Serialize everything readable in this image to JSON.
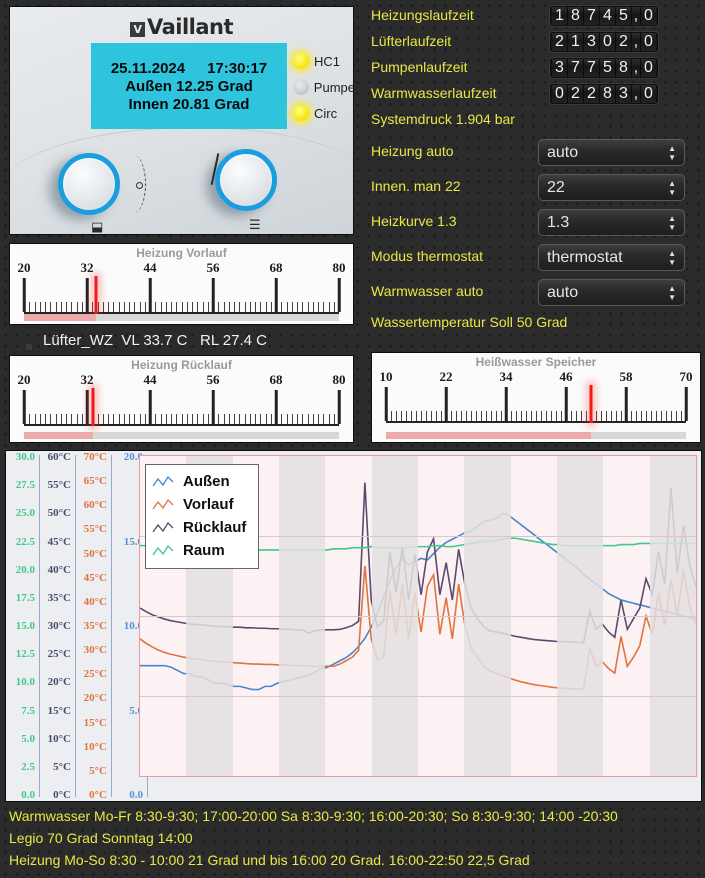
{
  "boiler": {
    "brand": "Vaillant",
    "brand_mark": "V",
    "display": {
      "date": "25.11.2024",
      "time": "17:30:17",
      "outside": "Außen 12.25 Grad",
      "inside": "Innen 20.81 Grad"
    },
    "leds": [
      {
        "label": "HC1",
        "state": "on"
      },
      {
        "label": "Pumpe",
        "state": "off"
      },
      {
        "label": "Circ",
        "state": "on"
      }
    ],
    "knob_left_icon": "⬓",
    "knob_right_icon": "☰"
  },
  "counters": [
    {
      "label": "Heizungslaufzeit",
      "digits": "18745",
      "decimal": "0",
      "separator": ","
    },
    {
      "label": "Lüfterlaufzeit",
      "digits": "21302",
      "decimal": "0",
      "separator": ","
    },
    {
      "label": "Pumpenlaufzeit",
      "digits": "37758",
      "decimal": "0",
      "separator": ","
    },
    {
      "label": "Warmwasserlaufzeit",
      "digits": "02283",
      "decimal": "0",
      "separator": ","
    }
  ],
  "system_pressure": "Systemdruck 1.904 bar",
  "water_temp_target": "Wassertemperatur Soll 50 Grad",
  "controls": [
    {
      "label": "Heizung auto",
      "value": "auto"
    },
    {
      "label": "Innen. man 22",
      "value": "22"
    },
    {
      "label": "Heizkurve 1.3",
      "value": "1.3"
    },
    {
      "label": "Modus thermostat",
      "value": "thermostat"
    },
    {
      "label": "Warmwasser auto",
      "value": "auto"
    }
  ],
  "status_line": {
    "lamp": "off",
    "text": "Lüfter_WZ  VL 33.7 C   RL 27.4 C"
  },
  "gauges": [
    {
      "title": "Heizung Vorlauf",
      "min": 20,
      "max": 80,
      "ticks": [
        20,
        32,
        44,
        56,
        68,
        80
      ],
      "value": 33.7
    },
    {
      "title": "Heizung Rücklauf",
      "min": 20,
      "max": 80,
      "ticks": [
        20,
        32,
        44,
        56,
        68,
        80
      ],
      "value": 33.2
    },
    {
      "title": "Heißwasser Speicher",
      "min": 10,
      "max": 70,
      "ticks": [
        10,
        22,
        34,
        46,
        58,
        70
      ],
      "value": 51.0
    }
  ],
  "chart_data": {
    "type": "line",
    "title": "",
    "xlabel": "",
    "grid": true,
    "legend_position": "top-left",
    "axes": [
      {
        "name": "Raum",
        "color": "#3fc98a",
        "min": 0.0,
        "max": 30.0,
        "step": 2.5,
        "ticks": [
          "0.0",
          "2.5",
          "5.0",
          "7.5",
          "10.0",
          "12.5",
          "15.0",
          "17.5",
          "20.0",
          "22.5",
          "25.0",
          "27.5",
          "30.0"
        ]
      },
      {
        "name": "Rücklauf",
        "color": "#4a4a6a",
        "min": 0,
        "max": 60,
        "step": 5,
        "ticks": [
          "0°C",
          "5°C",
          "10°C",
          "15°C",
          "20°C",
          "25°C",
          "30°C",
          "35°C",
          "40°C",
          "45°C",
          "50°C",
          "55°C",
          "60°C"
        ]
      },
      {
        "name": "Vorlauf",
        "color": "#e2733f",
        "min": 0,
        "max": 70,
        "step": 5,
        "ticks": [
          "0°C",
          "5°C",
          "10°C",
          "15°C",
          "20°C",
          "25°C",
          "30°C",
          "35°C",
          "40°C",
          "45°C",
          "50°C",
          "55°C",
          "60°C",
          "65°C",
          "70°C"
        ]
      },
      {
        "name": "Außen",
        "color": "#5a8fd0",
        "min": 0.0,
        "max": 20.0,
        "step": 5,
        "ticks": [
          "0.0",
          "5.0",
          "10.0",
          "15.0",
          "20.0"
        ]
      }
    ],
    "series": [
      {
        "name": "Außen",
        "color": "#4a86c8",
        "axis": "Außen",
        "values": [
          6.9,
          6.9,
          6.9,
          6.9,
          6.9,
          6.8,
          6.6,
          6.4,
          6.4,
          6.2,
          6.2,
          6.0,
          5.8,
          5.8,
          5.7,
          5.6,
          5.6,
          5.5,
          5.4,
          5.4,
          5.6,
          5.6,
          5.8,
          5.9,
          6.0,
          6.1,
          6.2,
          6.3,
          6.5,
          6.7,
          6.8,
          7.0,
          7.2,
          7.4,
          7.7,
          8.1,
          8.6,
          9.3,
          10.2,
          11.2,
          12.2,
          13.0,
          13.6,
          13.2,
          13.4,
          13.6,
          13.5,
          13.9,
          14.3,
          14.6,
          14.8,
          15.0,
          15.2,
          15.3,
          15.6,
          15.9,
          16.0,
          16.1,
          16.4,
          16.3,
          16.0,
          15.7,
          15.4,
          15.1,
          14.8,
          14.5,
          14.2,
          13.9,
          13.6,
          13.3,
          13.0,
          12.6,
          12.3,
          12.0,
          11.7,
          11.4,
          11.2,
          11.0,
          10.9,
          10.8,
          10.7,
          10.6,
          10.5,
          10.4,
          10.3,
          10.2,
          10.1,
          10.0,
          9.9,
          9.8
        ]
      },
      {
        "name": "Vorlauf",
        "color": "#e2733f",
        "axis": "Vorlauf",
        "values": [
          30.0,
          29.0,
          28.2,
          27.5,
          27.0,
          26.6,
          26.3,
          26.0,
          25.8,
          25.6,
          25.4,
          25.2,
          25.1,
          25.0,
          24.9,
          24.8,
          24.7,
          24.6,
          24.5,
          24.5,
          24.4,
          24.4,
          24.3,
          24.3,
          24.2,
          24.2,
          24.1,
          24.1,
          24.0,
          24.0,
          24.0,
          24.0,
          24.5,
          25.2,
          26.0,
          27.5,
          46.0,
          30.0,
          25.5,
          26.0,
          40.5,
          31.0,
          42.0,
          30.0,
          40.0,
          31.5,
          41.5,
          44.0,
          31.0,
          39.0,
          30.0,
          42.0,
          33.0,
          28.0,
          26.0,
          24.0,
          23.0,
          22.5,
          22.0,
          21.5,
          21.0,
          20.6,
          20.3,
          20.0,
          19.8,
          19.6,
          19.4,
          19.3,
          19.2,
          19.1,
          19.0,
          19.0,
          28.0,
          24.0,
          25.0,
          23.5,
          22.5,
          30.5,
          24.0,
          26.0,
          28.5,
          35.0,
          31.0,
          40.0,
          33.0,
          43.0,
          35.0,
          45.0,
          37.0,
          33.0
        ]
      },
      {
        "name": "Rücklauf",
        "color": "#5b4a6e",
        "axis": "Rücklauf",
        "values": [
          31.5,
          30.8,
          30.2,
          29.8,
          29.4,
          29.1,
          28.9,
          28.7,
          28.5,
          28.4,
          28.3,
          28.2,
          28.1,
          28.0,
          28.0,
          27.9,
          27.9,
          27.8,
          27.8,
          27.7,
          27.7,
          27.6,
          27.6,
          27.5,
          27.5,
          27.4,
          27.4,
          26.8,
          27.2,
          27.4,
          27.4,
          27.4,
          27.5,
          27.8,
          28.2,
          29.0,
          55.0,
          33.0,
          28.0,
          29.0,
          42.0,
          34.5,
          43.0,
          33.0,
          41.5,
          34.0,
          42.0,
          44.5,
          34.0,
          40.0,
          33.0,
          42.5,
          36.0,
          31.5,
          29.5,
          28.0,
          27.2,
          27.0,
          26.8,
          26.5,
          26.2,
          26.0,
          25.8,
          25.6,
          25.5,
          25.4,
          25.3,
          25.2,
          25.2,
          25.1,
          25.1,
          25.0,
          31.0,
          27.5,
          28.5,
          27.0,
          26.0,
          33.0,
          27.5,
          29.5,
          31.5,
          37.0,
          34.0,
          42.0,
          36.0,
          54.0,
          38.0,
          47.0,
          39.5,
          35.5
        ]
      },
      {
        "name": "Raum",
        "color": "#3fc98a",
        "axis": "Raum",
        "values": [
          21.6,
          21.6,
          21.6,
          21.5,
          21.5,
          21.5,
          21.5,
          21.5,
          21.4,
          21.4,
          21.4,
          21.4,
          21.4,
          21.3,
          21.3,
          21.3,
          21.3,
          21.3,
          21.3,
          21.2,
          21.2,
          21.2,
          21.2,
          21.2,
          21.2,
          21.2,
          21.2,
          21.2,
          21.2,
          21.2,
          21.2,
          21.3,
          21.3,
          21.3,
          21.4,
          21.4,
          21.4,
          21.5,
          21.4,
          21.4,
          21.4,
          21.4,
          21.4,
          21.4,
          21.5,
          21.5,
          21.5,
          21.6,
          21.6,
          21.5,
          21.5,
          21.6,
          21.7,
          21.8,
          21.9,
          22.0,
          22.0,
          22.1,
          22.2,
          22.3,
          22.3,
          22.2,
          22.1,
          22.0,
          21.9,
          21.8,
          21.7,
          21.7,
          21.6,
          21.6,
          21.6,
          21.6,
          21.6,
          21.6,
          21.6,
          21.6,
          21.6,
          21.7,
          21.7,
          21.7,
          21.8,
          21.8,
          21.8,
          21.8,
          21.8,
          21.8,
          21.8,
          21.8,
          21.8,
          21.8
        ]
      }
    ]
  },
  "schedule": [
    "Warmwasser Mo-Fr 8:30-9:30; 17:00-20:00 Sa 8:30-9:30; 16:00-20:30; So 8:30-9:30; 14:00 -20:30",
    "Legio 70 Grad Sonntag 14:00",
    "Heizung Mo-So 8:30 - 10:00 21 Grad und bis 16:00 20 Grad. 16:00-22:50 22,5 Grad"
  ]
}
